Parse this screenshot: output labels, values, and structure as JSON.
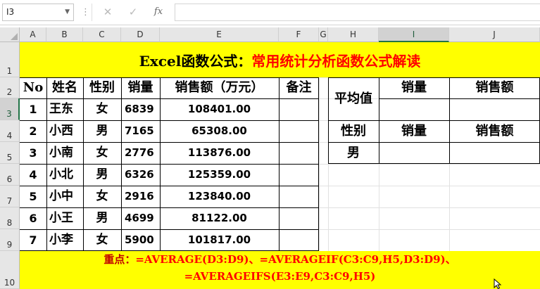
{
  "formula_bar": {
    "name_box": "I3",
    "name_box_dropdown_icon": "chevron-down-icon",
    "more_icon": "vertical-dots-icon",
    "cancel_icon": "close-icon",
    "confirm_icon": "check-icon",
    "function_icon": "fx-icon",
    "formula": ""
  },
  "selection": {
    "cell": "I3",
    "column": "I",
    "row": "3"
  },
  "columns": [
    "A",
    "B",
    "C",
    "D",
    "E",
    "F",
    "G",
    "H",
    "I",
    "J"
  ],
  "rows": [
    "1",
    "2",
    "3",
    "4",
    "5",
    "6",
    "7",
    "8",
    "9",
    "10"
  ],
  "title": {
    "part1": "Excel函数公式：",
    "part2": "常用统计分析函数公式解读"
  },
  "table": {
    "headers": [
      "No",
      "姓名",
      "性别",
      "销量",
      "销售额（万元）",
      "备注"
    ],
    "rows": [
      [
        "1",
        "王东",
        "女",
        "6839",
        "108401.00",
        ""
      ],
      [
        "2",
        "小西",
        "男",
        "7165",
        "65308.00",
        ""
      ],
      [
        "3",
        "小南",
        "女",
        "2776",
        "113876.00",
        ""
      ],
      [
        "4",
        "小北",
        "男",
        "6326",
        "125359.00",
        ""
      ],
      [
        "5",
        "小中",
        "女",
        "2916",
        "123840.00",
        ""
      ],
      [
        "6",
        "小王",
        "男",
        "4699",
        "81122.00",
        ""
      ],
      [
        "7",
        "小李",
        "女",
        "5900",
        "101817.00",
        ""
      ]
    ]
  },
  "side_table": {
    "avg_label": "平均值",
    "sales_header": "销量",
    "amount_header": "销售额",
    "gender_label": "性别",
    "sales_header2": "销量",
    "amount_header2": "销售额",
    "gender_value": "男",
    "avg_sales": "",
    "avg_amount": "",
    "male_sales": "",
    "male_amount": ""
  },
  "note": {
    "label": "重点：",
    "line1": "=AVERAGE(D3:D9)、=AVERAGEIF(C3:C9,H5,D3:D9)、",
    "line2": "=AVERAGEIFS(E3:E9,C3:C9,H5)"
  },
  "colors": {
    "band": "#ffff00",
    "accent_red": "#ff0000",
    "excel_green": "#217346"
  }
}
